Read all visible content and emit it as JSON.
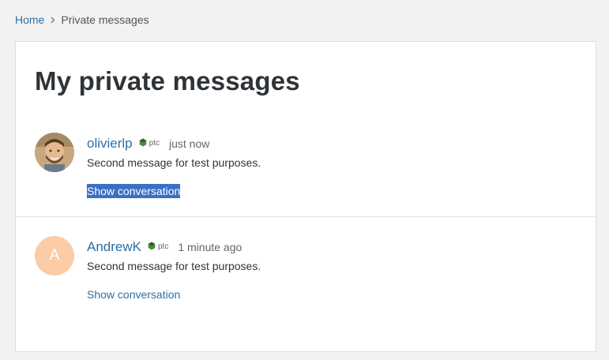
{
  "breadcrumb": {
    "home": "Home",
    "separator_icon": "chevron-right-icon",
    "current": "Private messages"
  },
  "page": {
    "title": "My private messages"
  },
  "messages": [
    {
      "username": "olivierlp",
      "badge": "ptc",
      "time": "just now",
      "body": "Second message for test purposes.",
      "link": "Show conversation",
      "avatar_type": "photo",
      "link_selected": true
    },
    {
      "username": "AndrewK",
      "badge": "ptc",
      "time": "1 minute ago",
      "body": "Second message for test purposes.",
      "link": "Show conversation",
      "avatar_type": "letter",
      "avatar_letter": "A",
      "avatar_color": "#fccca6",
      "link_selected": false
    }
  ],
  "colors": {
    "link": "#2e6fa7",
    "selection": "#3a6fc4",
    "badge_green": "#4a8c3a"
  }
}
